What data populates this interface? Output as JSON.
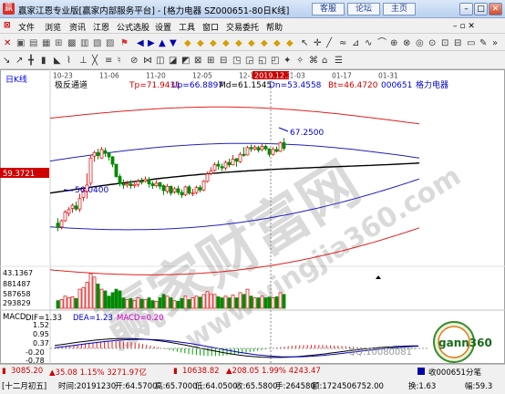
{
  "window": {
    "title": "赢家江恩专业版[赢家内部服务平台] - [格力电器  SZ000651-80日K线]",
    "buttons": [
      "客服",
      "论坛",
      "主页"
    ]
  },
  "menu": {
    "items": [
      "文件",
      "浏览",
      "资讯",
      "江恩",
      "公式选股",
      "设置",
      "工具",
      "窗口",
      "交易委托",
      "帮助"
    ]
  },
  "chart": {
    "period_label": "日K线",
    "indicator_name": "极反通道",
    "tp": "Tp=71.9431",
    "up": "Up=66.8897",
    "md": "Md=61.1545",
    "dn": "Dn=53.4558",
    "bt": "Bt=46.4720",
    "stock_code": "000651",
    "stock_name": "格力电器",
    "date_tag": "2019.12.30",
    "date_ticks": [
      "10-23",
      "11-06",
      "11-20",
      "12-05",
      "12-18",
      "01-03",
      "01-17",
      "01-31"
    ],
    "price_marker": "59.3721",
    "annotation_high": "67.2500",
    "annotation_low": "56.0400",
    "volume_max": "43.1367",
    "volume_ticks": [
      "881487",
      "587658",
      "293829"
    ],
    "macd_title": "MACD",
    "dif": "DIF=1.33",
    "dea": "DEA=1.23",
    "macd": "MACD=0.20",
    "macd_ticks": [
      "1.52",
      "0.95",
      "0.37",
      "-0.20",
      "-0.78"
    ],
    "watermark": "赢家财富网",
    "watermark_url": "www.yingjia360.com",
    "qq": "QQ:10080081",
    "logo_text": "gann360",
    "candles": [
      [
        53.4,
        52.7,
        54.2,
        52.1
      ],
      [
        52.8,
        53.8,
        54.0,
        52.4
      ],
      [
        53.8,
        55.2,
        55.5,
        53.6
      ],
      [
        55.0,
        55.6,
        56.0,
        54.5
      ],
      [
        55.8,
        56.3,
        56.6,
        55.1
      ],
      [
        56.2,
        55.7,
        56.9,
        55.4
      ],
      [
        55.7,
        57.4,
        58.2,
        55.2
      ],
      [
        57.6,
        58.6,
        59.3,
        57.0
      ],
      [
        58.6,
        59.6,
        61.5,
        57.4
      ],
      [
        59.9,
        64.0,
        64.5,
        59.5
      ],
      [
        64.3,
        64.9,
        65.2,
        63.4
      ],
      [
        64.9,
        64.4,
        65.5,
        63.8
      ],
      [
        64.0,
        65.4,
        65.8,
        63.9
      ],
      [
        65.2,
        64.8,
        65.7,
        64.2
      ],
      [
        64.8,
        64.2,
        65.0,
        63.6
      ],
      [
        64.2,
        63.0,
        64.3,
        62.5
      ],
      [
        63.0,
        61.0,
        63.0,
        60.8
      ],
      [
        61.0,
        59.9,
        61.4,
        59.4
      ],
      [
        59.8,
        59.6,
        60.5,
        59.0
      ],
      [
        59.6,
        59.8,
        60.3,
        59.2
      ],
      [
        59.8,
        59.5,
        60.4,
        59.0
      ],
      [
        59.5,
        59.7,
        60.0,
        59.1
      ],
      [
        59.7,
        60.2,
        60.6,
        59.3
      ],
      [
        60.2,
        60.1,
        60.8,
        59.7
      ],
      [
        60.2,
        60.5,
        61.0,
        60.0
      ],
      [
        60.5,
        59.8,
        60.9,
        59.2
      ],
      [
        59.8,
        59.5,
        60.2,
        59.0
      ],
      [
        59.5,
        59.9,
        60.4,
        59.2
      ],
      [
        60.0,
        59.4,
        60.1,
        58.9
      ],
      [
        59.5,
        58.7,
        59.7,
        58.0
      ],
      [
        58.6,
        59.4,
        59.8,
        58.2
      ],
      [
        59.4,
        58.3,
        59.5,
        57.9
      ],
      [
        58.5,
        59.0,
        59.3,
        58.2
      ],
      [
        59.0,
        58.4,
        59.5,
        58.0
      ],
      [
        58.4,
        58.0,
        58.9,
        57.5
      ],
      [
        58.0,
        59.3,
        59.5,
        57.8
      ],
      [
        59.3,
        58.3,
        59.6,
        58.0
      ],
      [
        58.2,
        58.3,
        59.0,
        57.8
      ],
      [
        58.4,
        59.2,
        59.5,
        58.1
      ],
      [
        59.2,
        58.8,
        59.6,
        58.4
      ],
      [
        58.8,
        60.2,
        60.4,
        58.6
      ],
      [
        60.2,
        61.4,
        61.8,
        60.0
      ],
      [
        61.5,
        61.9,
        62.5,
        61.2
      ],
      [
        62.0,
        62.9,
        63.3,
        61.8
      ],
      [
        63.0,
        62.7,
        63.6,
        62.1
      ],
      [
        62.6,
        62.4,
        63.1,
        61.9
      ],
      [
        62.4,
        63.3,
        63.6,
        62.0
      ],
      [
        63.3,
        62.9,
        63.9,
        62.5
      ],
      [
        62.9,
        63.8,
        64.5,
        62.8
      ],
      [
        63.9,
        63.5,
        64.0,
        62.6
      ],
      [
        63.4,
        64.6,
        65.0,
        63.2
      ],
      [
        64.6,
        64.5,
        65.8,
        64.2
      ],
      [
        64.5,
        65.7,
        66.0,
        64.4
      ],
      [
        65.7,
        65.5,
        66.2,
        65.0
      ],
      [
        65.5,
        65.8,
        66.1,
        65.2
      ],
      [
        65.7,
        65.3,
        66.0,
        64.9
      ],
      [
        65.4,
        65.9,
        66.3,
        65.1
      ],
      [
        65.9,
        65.5,
        66.2,
        65.2
      ],
      [
        65.5,
        64.6,
        65.6,
        64.2
      ],
      [
        64.6,
        65.4,
        65.8,
        64.4
      ],
      [
        65.4,
        65.1,
        65.9,
        64.9
      ],
      [
        65.1,
        66.5,
        66.7,
        65.0
      ],
      [
        66.5,
        65.6,
        67.25,
        65.2
      ]
    ],
    "volumes": [
      0.22,
      0.25,
      0.35,
      0.3,
      0.33,
      0.28,
      0.55,
      0.6,
      0.75,
      1.0,
      0.9,
      0.7,
      0.55,
      0.5,
      0.35,
      0.45,
      0.55,
      0.5,
      0.3,
      0.25,
      0.28,
      0.22,
      0.3,
      0.26,
      0.25,
      0.3,
      0.22,
      0.2,
      0.3,
      0.4,
      0.35,
      0.3,
      0.22,
      0.2,
      0.28,
      0.35,
      0.25,
      0.3,
      0.35,
      0.32,
      0.4,
      0.48,
      0.42,
      0.4,
      0.33,
      0.3,
      0.35,
      0.3,
      0.38,
      0.3,
      0.45,
      0.4,
      0.55,
      0.35,
      0.3,
      0.3,
      0.35,
      0.3,
      0.32,
      0.3,
      0.33,
      0.45,
      0.4
    ]
  },
  "status": {
    "period": "[十二月初五]",
    "time": "时间:20191230",
    "open": "开:64.5700",
    "high": "高:65.7000",
    "low": "低:64.0500",
    "close": "收:65.5800",
    "volume": "手:264580",
    "amount": "额:1724506752.00",
    "change": "换:1.63",
    "amp": "幅:59.3",
    "index1": "3085.20",
    "index1_chg": "▲35.08 1.15% 3271.97亿",
    "index2": "10638.82",
    "index2_chg": "▲208.05 1.99% 4243.47",
    "minute_label": "收000651分笔"
  }
}
